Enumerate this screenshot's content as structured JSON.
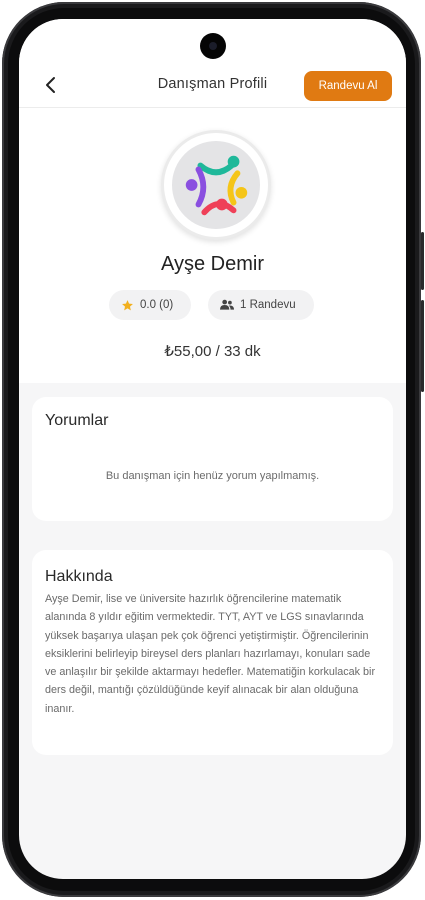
{
  "header": {
    "title": "Danışman Profili",
    "appointment_button": "Randevu Al"
  },
  "profile": {
    "name": "Ayşe Demir",
    "rating": "0.0 (0)",
    "appointments": "1 Randevu",
    "price": "₺55,00 / 33 dk"
  },
  "reviews": {
    "title": "Yorumlar",
    "empty_text": "Bu danışman için henüz yorum yapılmamış."
  },
  "about": {
    "title": "Hakkında",
    "text": "Ayşe Demir, lise ve üniversite hazırlık öğrencilerine matematik alanında 8 yıldır eğitim vermektedir. TYT, AYT ve LGS sınavlarında yüksek başarıya ulaşan pek çok öğrenci yetiştirmiştir. Öğrencilerinin eksiklerini belirleyip bireysel ders planları hazırlamayı, konuları sade ve anlaşılır bir şekilde aktarmayı hedefler. Matematiğin korkulacak bir ders değil, mantığı çözüldüğünde keyif alınacak bir alan olduğuna inanır."
  },
  "colors": {
    "accent": "#e07a12",
    "star": "#f2b01e",
    "logo_teal": "#1fb89a",
    "logo_yellow": "#f5c518",
    "logo_red": "#ef4058",
    "logo_purple": "#8a4fe0"
  },
  "icons": {
    "back": "chevron-left-icon",
    "rating": "star-icon",
    "appointments": "people-icon"
  }
}
